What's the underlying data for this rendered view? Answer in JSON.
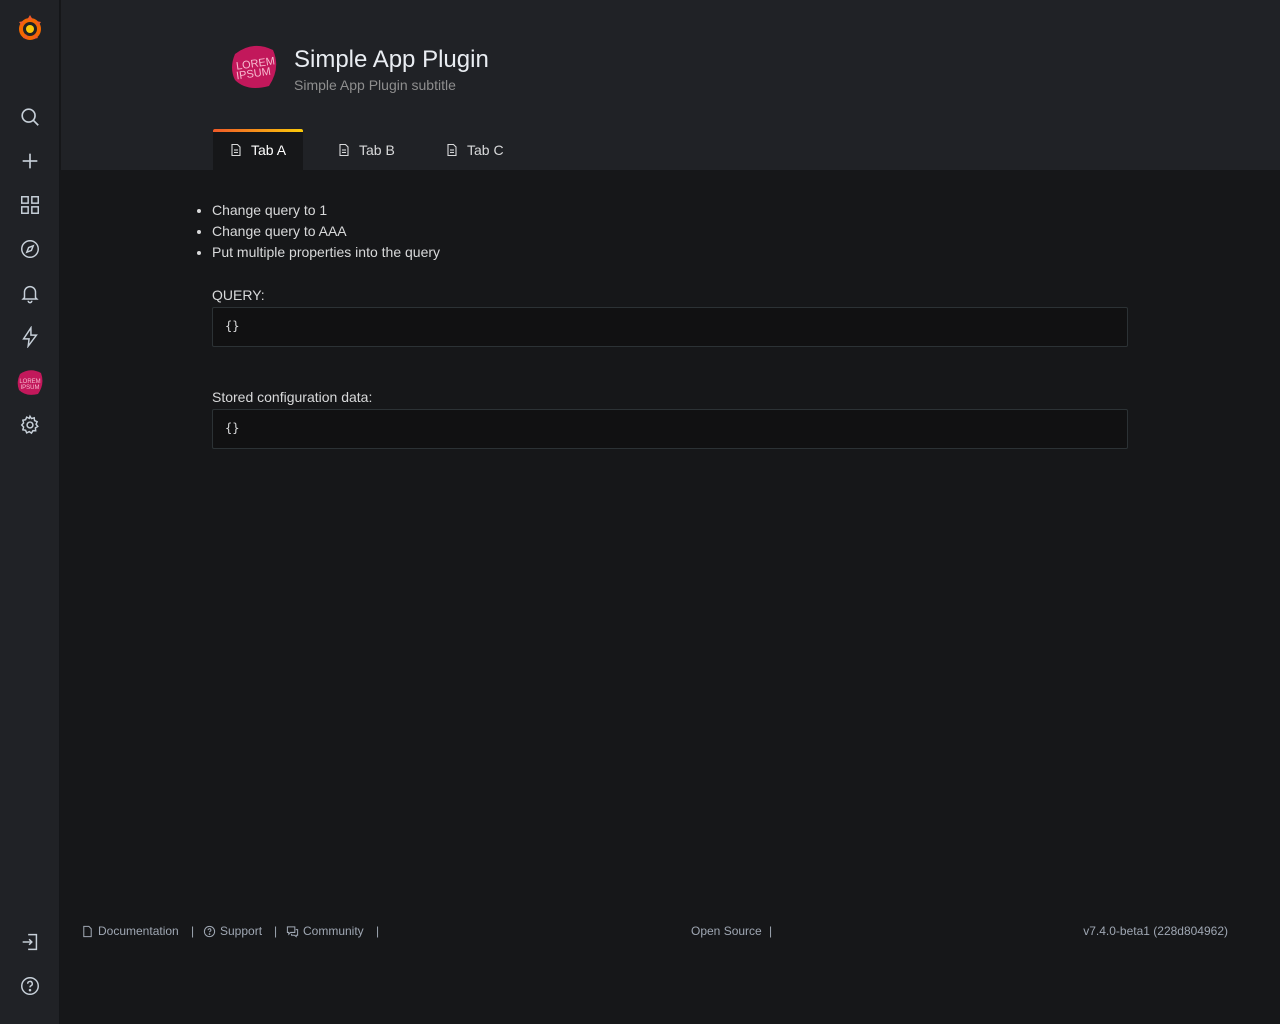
{
  "sidebar": {
    "items": [
      {
        "name": "search-icon"
      },
      {
        "name": "plus-icon"
      },
      {
        "name": "dashboards-icon"
      },
      {
        "name": "explore-icon"
      },
      {
        "name": "bell-icon"
      },
      {
        "name": "bolt-icon"
      },
      {
        "name": "plugin-logo-icon"
      },
      {
        "name": "gear-icon"
      }
    ],
    "bottom": [
      {
        "name": "sign-in-icon"
      },
      {
        "name": "help-icon"
      }
    ]
  },
  "header": {
    "title": "Simple App Plugin",
    "subtitle": "Simple App Plugin subtitle",
    "logo_text": "LOREM IPSUM",
    "tabs": [
      {
        "label": "Tab A",
        "active": true
      },
      {
        "label": "Tab B",
        "active": false
      },
      {
        "label": "Tab C",
        "active": false
      }
    ]
  },
  "content": {
    "links": [
      "Change query to 1",
      "Change query to AAA",
      "Put multiple properties into the query"
    ],
    "query_label": "QUERY:",
    "query_value": "{}",
    "config_label": "Stored configuration data:",
    "config_value": "{}"
  },
  "footer": {
    "documentation": "Documentation",
    "support": "Support",
    "community": "Community",
    "open_source": "Open Source",
    "separator": "|",
    "version": "v7.4.0-beta1 (228d804962)"
  },
  "colors": {
    "accent_gradient_start": "#f05a28",
    "accent_gradient_end": "#fbca0a",
    "plugin_logo": "#c2185b"
  }
}
